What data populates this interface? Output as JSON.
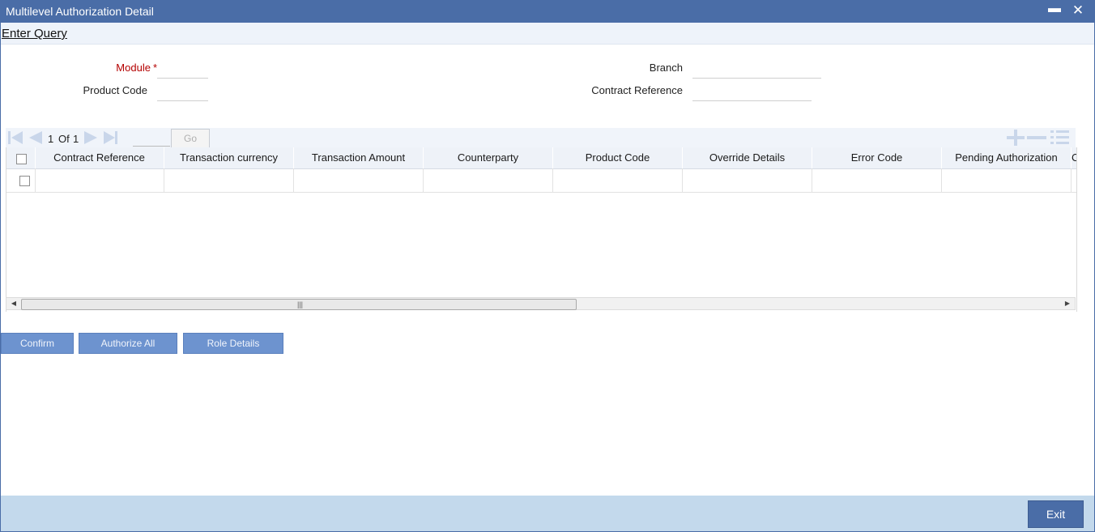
{
  "window": {
    "title": "Multilevel Authorization Detail",
    "minimize_glyph": "▬",
    "close_glyph": "✕"
  },
  "toolbar": {
    "enter_query": "Enter Query"
  },
  "form": {
    "module": {
      "label": "Module",
      "required_mark": "*",
      "value": ""
    },
    "product_code": {
      "label": "Product Code",
      "value": ""
    },
    "branch": {
      "label": "Branch",
      "value": ""
    },
    "contract_reference": {
      "label": "Contract Reference",
      "value": ""
    }
  },
  "pager": {
    "current": "1",
    "of_label": "Of",
    "total": "1",
    "go_label": "Go",
    "page_input": ""
  },
  "grid": {
    "columns": [
      "Contract Reference",
      "Transaction currency",
      "Transaction Amount",
      "Counterparty",
      "Product Code",
      "Override Details",
      "Error Code",
      "Pending Authorization",
      "C"
    ],
    "rows": [
      {
        "cells": [
          "",
          "",
          "",
          "",
          "",
          "",
          "",
          ""
        ]
      }
    ]
  },
  "actions": {
    "confirm": "Confirm",
    "authorize_all": "Authorize All",
    "role_details": "Role Details"
  },
  "footer": {
    "exit": "Exit"
  },
  "colors": {
    "titlebar": "#4a6da7",
    "action_button": "#6d93cf",
    "footer": "#c3d9ec",
    "required": "#b40000"
  },
  "icons": [
    "first-page-icon",
    "prev-page-icon",
    "next-page-icon",
    "last-page-icon",
    "add-row-icon",
    "delete-row-icon",
    "single-view-icon"
  ]
}
